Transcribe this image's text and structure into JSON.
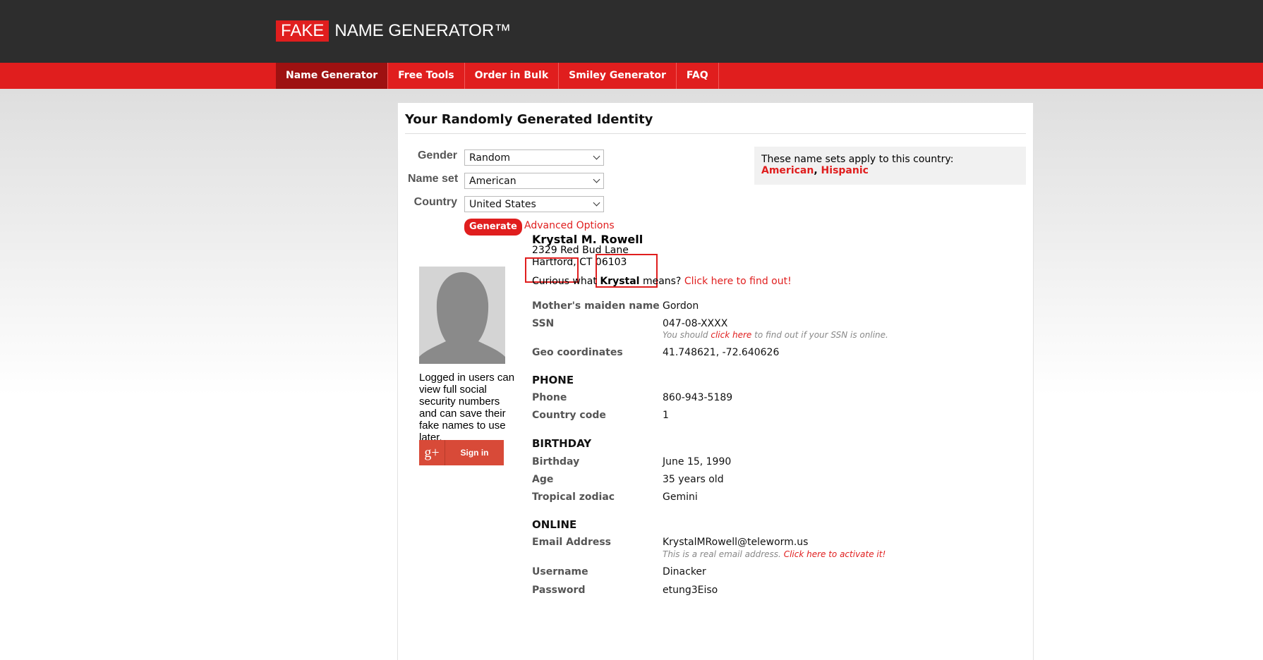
{
  "header": {
    "logo_fake": "FAKE",
    "logo_rest": "NAME GENERATOR™",
    "nav": [
      "Name Generator",
      "Free Tools",
      "Order in Bulk",
      "Smiley Generator",
      "FAQ"
    ]
  },
  "title": "Your Randomly Generated Identity",
  "form": {
    "gender_label": "Gender",
    "gender_value": "Random",
    "nameset_label": "Name set",
    "nameset_value": "American",
    "country_label": "Country",
    "country_value": "United States",
    "generate": "Generate",
    "advanced": "Advanced Options"
  },
  "info": {
    "text": "These name sets apply to this country:",
    "set1": "American",
    "sep": ",",
    "set2": "Hispanic"
  },
  "sidebar": {
    "note": "Logged in users can view full social security numbers and can save their fake names to use later.",
    "google_icon": "g+",
    "signin": "Sign in"
  },
  "identity": {
    "name": "Krystal M. Rowell",
    "address1": "2329 Red Bud Lane",
    "address2": "Hartford, CT 06103",
    "curious_pre": "Curious what",
    "curious_name": "Krystal",
    "curious_mid": "means?",
    "curious_link": "Click here to find out!",
    "maiden_label": "Mother's maiden name",
    "maiden_value": "Gordon",
    "ssn_label": "SSN",
    "ssn_value": "047-08-XXXX",
    "ssn_hint_pre": "You should",
    "ssn_hint_link": "click here",
    "ssn_hint_post": "to find out if your SSN is online.",
    "geo_label": "Geo coordinates",
    "geo_value": "41.748621, -72.640626"
  },
  "phone": {
    "heading": "PHONE",
    "phone_label": "Phone",
    "phone_value": "860-943-5189",
    "cc_label": "Country code",
    "cc_value": "1"
  },
  "birthday": {
    "heading": "BIRTHDAY",
    "bday_label": "Birthday",
    "bday_value": "June 15, 1990",
    "age_label": "Age",
    "age_value": "35 years old",
    "zodiac_label": "Tropical zodiac",
    "zodiac_value": "Gemini"
  },
  "online": {
    "heading": "ONLINE",
    "email_label": "Email Address",
    "email_value": "KrystalMRowell@teleworm.us",
    "email_hint": "This is a real email address.",
    "email_link": "Click here to activate it!",
    "user_label": "Username",
    "user_value": "Dinacker",
    "pass_label": "Password",
    "pass_value": "etung3Eiso"
  },
  "colors": {
    "brand_red": "#e01e1e",
    "dark_header": "#2d2d2d",
    "nav_active": "#9e1111"
  }
}
